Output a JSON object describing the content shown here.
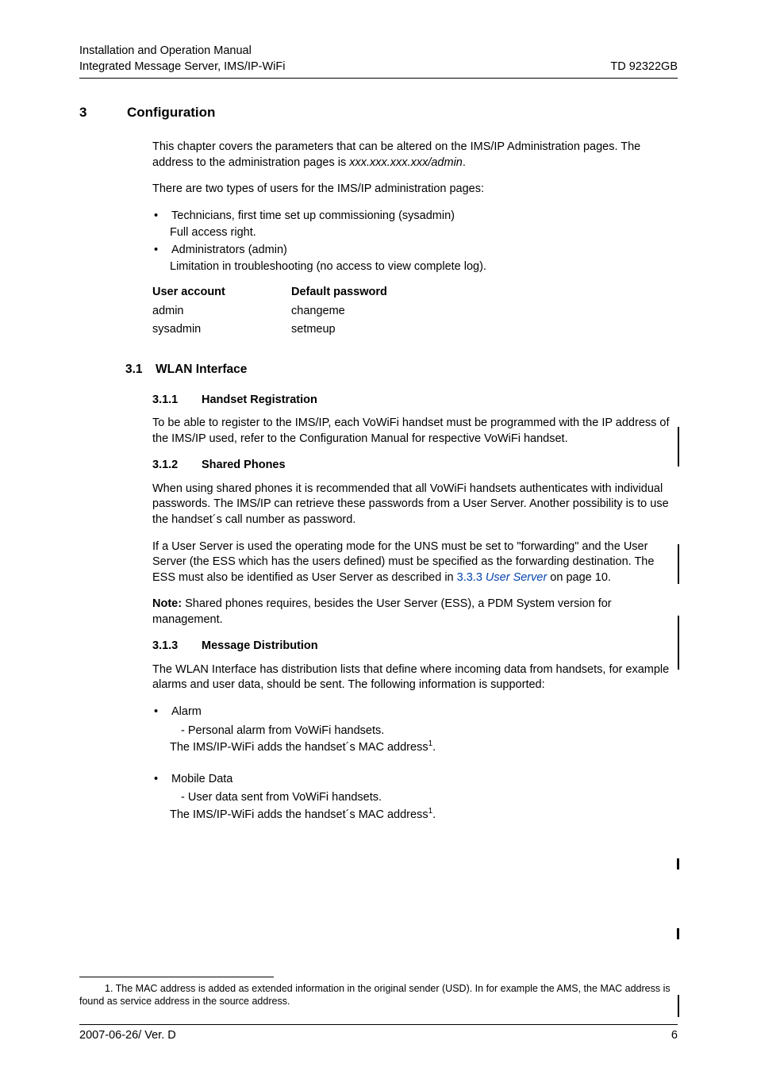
{
  "header": {
    "line1": "Installation and Operation Manual",
    "line2_left": "Integrated Message Server, IMS/IP-WiFi",
    "line2_right": "TD 92322GB"
  },
  "chapter": {
    "num": "3",
    "title": "Configuration"
  },
  "intro": {
    "p1_a": "This chapter covers the parameters that can be altered on the IMS/IP Administration pages. The address to the administration pages is ",
    "p1_i": "xxx.xxx.xxx.xxx/admin",
    "p1_b": ".",
    "p2": "There are two types of users for the IMS/IP administration pages:",
    "b1": "Technicians, first time set up commissioning (sysadmin)",
    "b1_sub": "Full access right.",
    "b2": "Administrators (admin)",
    "b2_sub": "Limitation in troubleshooting (no access to view complete log)."
  },
  "table": {
    "h1": "User account",
    "h2": "Default password",
    "r1c1": "admin",
    "r1c2": "changeme",
    "r2c1": "sysadmin",
    "r2c2": "setmeup"
  },
  "s31": {
    "num": "3.1",
    "title": "WLAN Interface"
  },
  "s311": {
    "num": "3.1.1",
    "title": "Handset Registration",
    "p": "To be able to register to the IMS/IP, each VoWiFi handset must be programmed with the IP address of the IMS/IP used, refer to the Configuration Manual for respective VoWiFi handset."
  },
  "s312": {
    "num": "3.1.2",
    "title": "Shared Phones",
    "p1": "When using shared phones it is recommended that all VoWiFi handsets authenticates with individual passwords. The IMS/IP can retrieve these passwords from a User Server. Another possibility is to use the handset´s call number as password.",
    "p2_a": "If a User Server is used the operating mode for the UNS must be set to \"forwarding\" and the User Server (the ESS which has the users defined) must be specified as the forwarding destination. The ESS must also be identified as User Server as described in ",
    "p2_link": "3.3.3 ",
    "p2_link_i": "User Server",
    "p2_b": " on page 10.",
    "note_label": "Note: ",
    "note": "Shared phones requires, besides the User Server (ESS), a PDM System version for management."
  },
  "s313": {
    "num": "3.1.3",
    "title": "Message Distribution",
    "p": "The WLAN Interface has distribution lists that define where incoming data from handsets, for example alarms and user data, should be sent. The following information is supported:",
    "b1_head": "Alarm",
    "b1_l1": "-  Personal alarm from VoWiFi handsets.",
    "b1_l2_a": "The IMS/IP-WiFi adds the handset´s MAC address",
    "b1_l2_sup": "1",
    "b1_l2_b": ".",
    "b2_head": "Mobile Data",
    "b2_l1": "-  User data sent from VoWiFi handsets.",
    "b2_l2_a": "The IMS/IP-WiFi adds the handset´s MAC address",
    "b2_l2_sup": "1",
    "b2_l2_b": "."
  },
  "footnote": {
    "text": "1. The MAC address is added as extended information in the original sender (USD). In for example the AMS, the MAC address is found as service address in the source address."
  },
  "footer": {
    "left": "2007-06-26/ Ver. D",
    "right": "6"
  }
}
